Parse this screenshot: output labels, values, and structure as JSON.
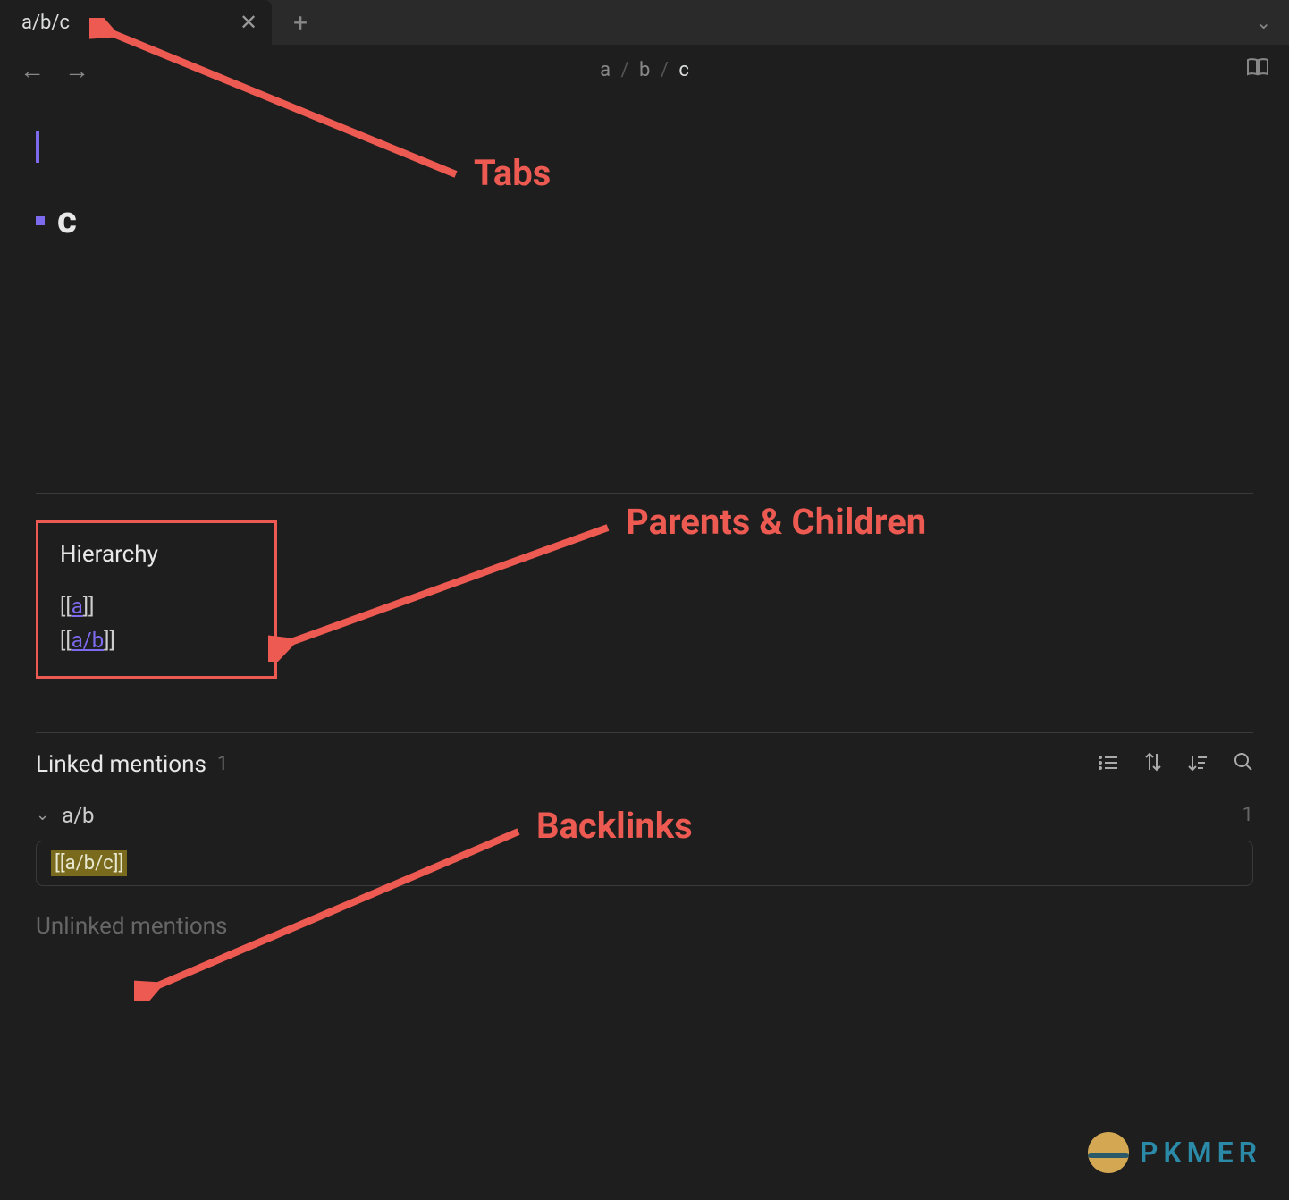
{
  "tab": {
    "title": "a/b/c"
  },
  "breadcrumb": {
    "a": "a",
    "b": "b",
    "c": "c",
    "sep": "/"
  },
  "content": {
    "heading": "c"
  },
  "hierarchy": {
    "title": "Hierarchy",
    "link1": "a",
    "link2": "a/b"
  },
  "backlinks": {
    "linked_title": "Linked mentions",
    "linked_count": "1",
    "group_name": "a/b",
    "group_count": "1",
    "mention_text": "[[a/b/c]]",
    "unlinked_title": "Unlinked mentions"
  },
  "annotations": {
    "tabs": "Tabs",
    "parents": "Parents & Children",
    "backlinks": "Backlinks"
  },
  "watermark": "PKMER"
}
